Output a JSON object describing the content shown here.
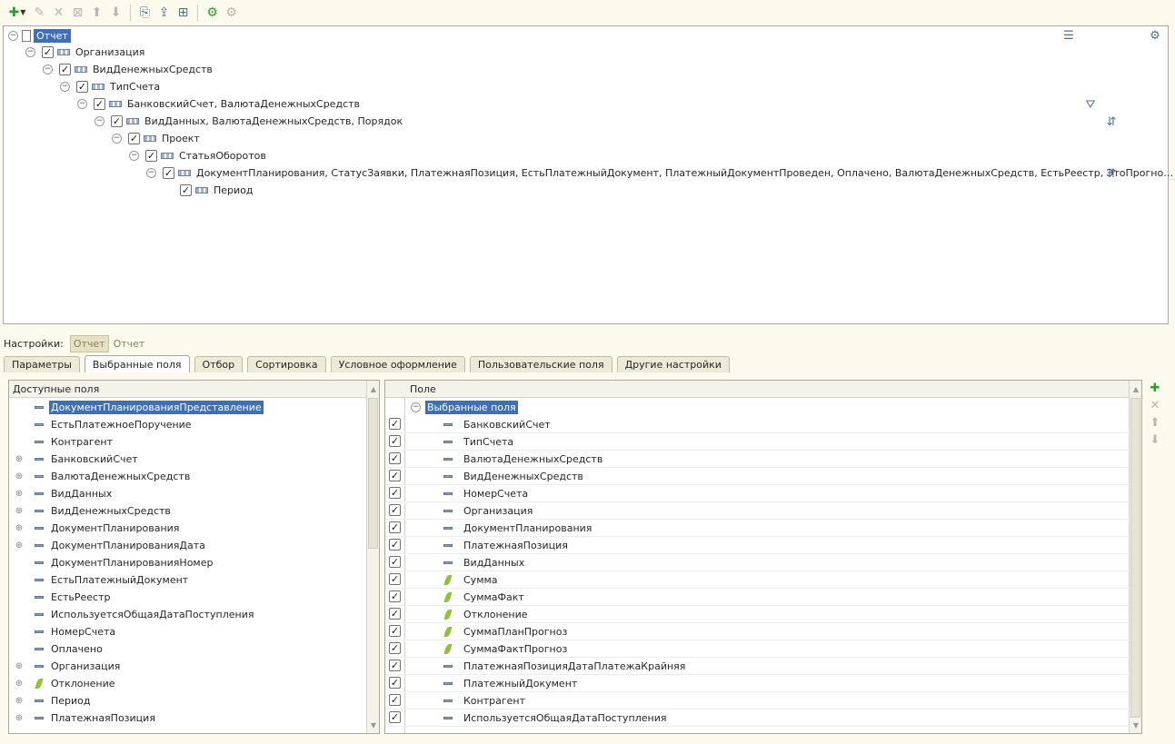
{
  "toolbar": {
    "icons": [
      {
        "name": "add-icon",
        "glyph": "✚",
        "cls": "green",
        "dropdown": true
      },
      {
        "name": "edit-icon",
        "glyph": "✎",
        "cls": "gray"
      },
      {
        "name": "delete-icon",
        "glyph": "✕",
        "cls": "gray"
      },
      {
        "name": "clear-icon",
        "glyph": "⊠",
        "cls": "gray"
      },
      {
        "name": "move-up-icon",
        "glyph": "⬆",
        "cls": "gray"
      },
      {
        "name": "move-down-icon",
        "glyph": "⬇",
        "cls": "gray",
        "sep_after": true
      },
      {
        "name": "group-icon",
        "glyph": "⎘",
        "cls": "blue"
      },
      {
        "name": "ungroup-icon",
        "glyph": "⇪",
        "cls": "blue"
      },
      {
        "name": "structure-icon",
        "glyph": "⊞",
        "cls": "blue",
        "sep_after": true
      },
      {
        "name": "settings-add-icon",
        "glyph": "⚙",
        "cls": "green"
      },
      {
        "name": "settings-icon",
        "glyph": "⚙",
        "cls": "gray"
      }
    ]
  },
  "tree": [
    {
      "label": "Отчет",
      "type": "doc",
      "checked": false,
      "selected": true,
      "expander": true
    },
    {
      "label": "Организация",
      "type": "group",
      "checked": true,
      "expander": true
    },
    {
      "label": "ВидДенежныхСредств",
      "type": "group",
      "checked": true,
      "expander": true
    },
    {
      "label": "ТипСчета",
      "type": "group",
      "checked": true,
      "expander": true
    },
    {
      "label": "БанковскийСчет, ВалютаДенежныхСредств",
      "type": "group",
      "checked": true,
      "expander": true,
      "right_icon": "filter-icon"
    },
    {
      "label": "ВидДанных, ВалютаДенежныхСредств, Порядок",
      "type": "group",
      "checked": true,
      "expander": true,
      "right_icon": "order-icon"
    },
    {
      "label": "Проект",
      "type": "group",
      "checked": true,
      "expander": true
    },
    {
      "label": "СтатьяОборотов",
      "type": "group",
      "checked": true,
      "expander": true
    },
    {
      "label": "ДокументПланирования, СтатусЗаявки, ПлатежнаяПозиция, ЕстьПлатежныйДокумент, ПлатежныйДокументПроведен, Оплачено, ВалютаДенежныхСредств, ЕстьРеестр, ЭтоПрогно…",
      "type": "group",
      "checked": true,
      "expander": true,
      "right_icon": "order-icon"
    },
    {
      "label": "Период",
      "type": "group",
      "checked": true,
      "expander": false
    }
  ],
  "settings": {
    "label": "Настройки:",
    "button": "Отчет",
    "link": "Отчет"
  },
  "tabs": [
    {
      "label": "Параметры"
    },
    {
      "label": "Выбранные поля",
      "active": true
    },
    {
      "label": "Отбор"
    },
    {
      "label": "Сортировка"
    },
    {
      "label": "Условное оформление"
    },
    {
      "label": "Пользовательские поля"
    },
    {
      "label": "Другие настройки"
    }
  ],
  "available": {
    "header": "Доступные поля",
    "items": [
      {
        "label": "ДокументПланированияПредставление",
        "icon": "field",
        "expand": false,
        "selected": true
      },
      {
        "label": "ЕстьПлатежноеПоручение",
        "icon": "field",
        "expand": false
      },
      {
        "label": "Контрагент",
        "icon": "field",
        "expand": false
      },
      {
        "label": "БанковскийСчет",
        "icon": "field",
        "expand": true
      },
      {
        "label": "ВалютаДенежныхСредств",
        "icon": "field",
        "expand": true
      },
      {
        "label": "ВидДанных",
        "icon": "field",
        "expand": true
      },
      {
        "label": "ВидДенежныхСредств",
        "icon": "field",
        "expand": true
      },
      {
        "label": "ДокументПланирования",
        "icon": "field",
        "expand": true
      },
      {
        "label": "ДокументПланированияДата",
        "icon": "field",
        "expand": true
      },
      {
        "label": "ДокументПланированияНомер",
        "icon": "field",
        "expand": false
      },
      {
        "label": "ЕстьПлатежныйДокумент",
        "icon": "field",
        "expand": false
      },
      {
        "label": "ЕстьРеестр",
        "icon": "field",
        "expand": false
      },
      {
        "label": "ИспользуетсяОбщаяДатаПоступления",
        "icon": "field",
        "expand": false
      },
      {
        "label": "НомерСчета",
        "icon": "field",
        "expand": false
      },
      {
        "label": "Оплачено",
        "icon": "field",
        "expand": false
      },
      {
        "label": "Организация",
        "icon": "field",
        "expand": true
      },
      {
        "label": "Отклонение",
        "icon": "resource",
        "expand": true
      },
      {
        "label": "Период",
        "icon": "field",
        "expand": true
      },
      {
        "label": "ПлатежнаяПозиция",
        "icon": "field",
        "expand": true
      }
    ]
  },
  "selected": {
    "header": "Поле",
    "root": "Выбранные поля",
    "items": [
      {
        "label": "БанковскийСчет",
        "icon": "field",
        "checked": true
      },
      {
        "label": "ТипСчета",
        "icon": "field",
        "checked": true
      },
      {
        "label": "ВалютаДенежныхСредств",
        "icon": "field",
        "checked": true
      },
      {
        "label": "ВидДенежныхСредств",
        "icon": "field",
        "checked": true
      },
      {
        "label": "НомерСчета",
        "icon": "field",
        "checked": true
      },
      {
        "label": "Организация",
        "icon": "field",
        "checked": true
      },
      {
        "label": "ДокументПланирования",
        "icon": "field",
        "checked": true
      },
      {
        "label": "ПлатежнаяПозиция",
        "icon": "field",
        "checked": true
      },
      {
        "label": "ВидДанных",
        "icon": "field",
        "checked": true
      },
      {
        "label": "Сумма",
        "icon": "resource",
        "checked": true
      },
      {
        "label": "СуммаФакт",
        "icon": "resource",
        "checked": true
      },
      {
        "label": "Отклонение",
        "icon": "resource",
        "checked": true
      },
      {
        "label": "СуммаПланПрогноз",
        "icon": "resource",
        "checked": true
      },
      {
        "label": "СуммаФактПрогноз",
        "icon": "resource",
        "checked": true
      },
      {
        "label": "ПлатежнаяПозицияДатаПлатежаКрайняя",
        "icon": "field",
        "checked": true
      },
      {
        "label": "ПлатежныйДокумент",
        "icon": "field",
        "checked": true
      },
      {
        "label": "Контрагент",
        "icon": "field",
        "checked": true
      },
      {
        "label": "ИспользуетсяОбщаяДатаПоступления",
        "icon": "field",
        "checked": true
      }
    ]
  },
  "side_buttons": [
    {
      "name": "add-field-icon",
      "glyph": "✚",
      "cls": "green"
    },
    {
      "name": "delete-field-icon",
      "glyph": "✕",
      "cls": "gray"
    },
    {
      "name": "move-field-up-icon",
      "glyph": "⬆",
      "cls": "gray"
    },
    {
      "name": "move-field-down-icon",
      "glyph": "⬇",
      "cls": "gray"
    }
  ],
  "struct_icons": [
    {
      "name": "output-settings-icon",
      "glyph": "☰"
    },
    {
      "name": "report-settings-icon",
      "glyph": "⚙"
    }
  ]
}
